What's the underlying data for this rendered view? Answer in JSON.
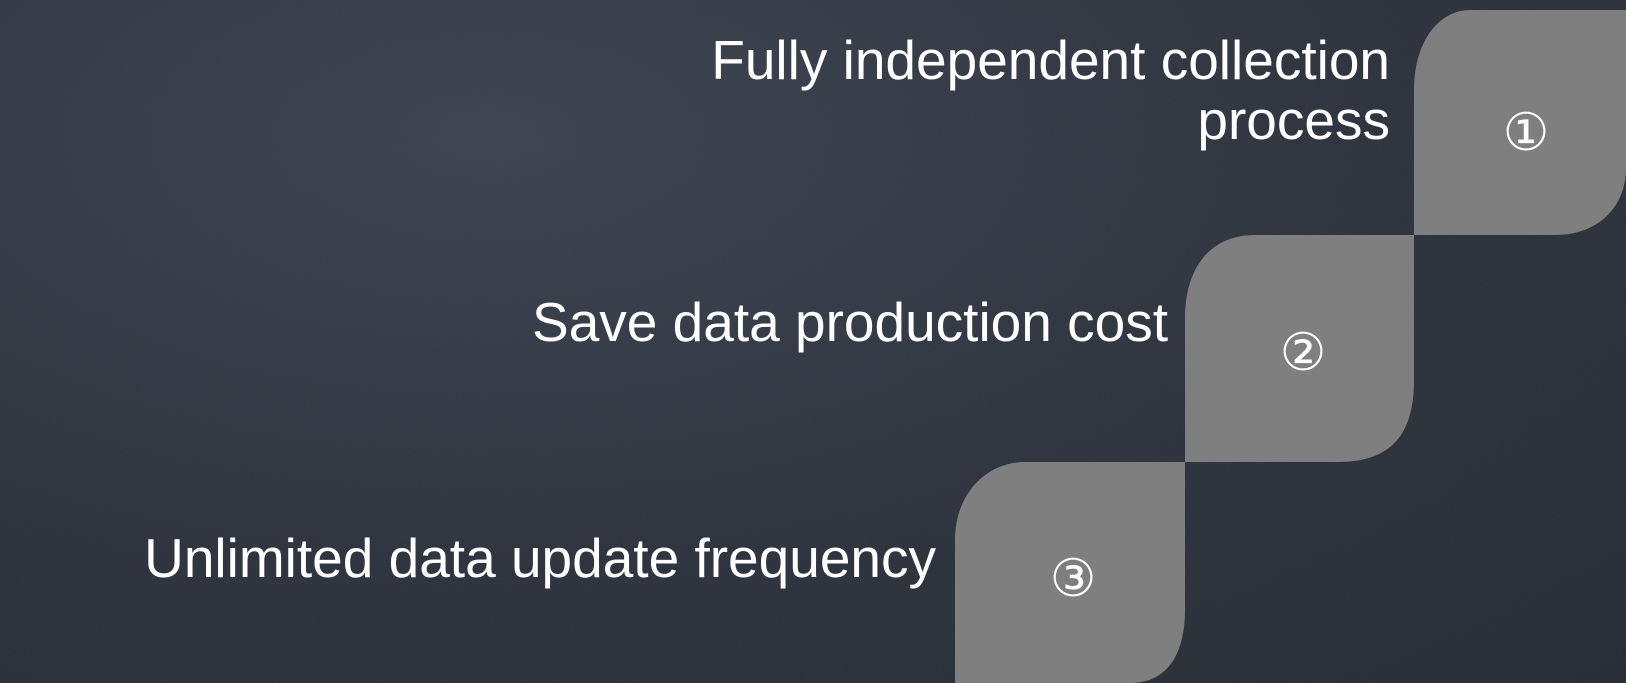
{
  "steps": [
    {
      "number": "①",
      "label_line1": "Fully independent collection",
      "label_line2": "process"
    },
    {
      "number": "②",
      "label": "Save data production cost"
    },
    {
      "number": "③",
      "label": "Unlimited data update frequency"
    }
  ],
  "colors": {
    "background": "#2c323c",
    "shape_fill": "#7f7f7f",
    "text": "#ffffff"
  }
}
